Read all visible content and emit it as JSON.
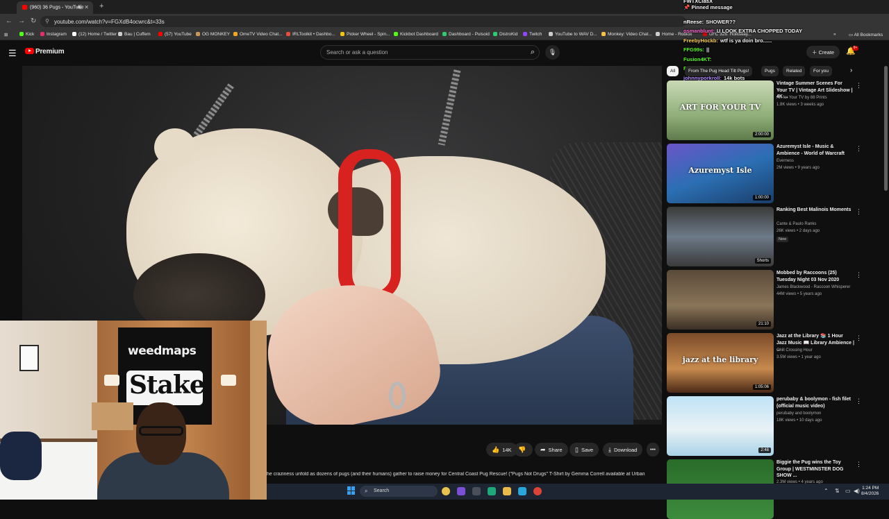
{
  "browser": {
    "tab_title": "(960) 36 Pugs - YouTube",
    "url": "youtube.com/watch?v=FGXdB4ocwrc&t=33s",
    "bookmarks": [
      {
        "label": "Kick",
        "color": "#53fc18"
      },
      {
        "label": "Instagram",
        "color": "#e1306c"
      },
      {
        "label": "(12) Home / Twitter",
        "color": "#ffffff"
      },
      {
        "label": "Bau | Cuffem",
        "color": "#cccccc"
      },
      {
        "label": "(57) YouTube",
        "color": "#ff0000"
      },
      {
        "label": "OG MONKEY",
        "color": "#c89a5a"
      },
      {
        "label": "OmeTV Video Chat...",
        "color": "#f5a623"
      },
      {
        "label": "IRLToolkit • Dashbo...",
        "color": "#e74c3c"
      },
      {
        "label": "Picker Wheel - Spin...",
        "color": "#f1c40f"
      },
      {
        "label": "Kickbot Dashboard",
        "color": "#53fc18"
      },
      {
        "label": "Dashboard - Pulsoid",
        "color": "#2ecc71"
      },
      {
        "label": "DistroKid",
        "color": "#2ecc71"
      },
      {
        "label": "Twitch",
        "color": "#9146ff"
      },
      {
        "label": "YouTube to WAV D...",
        "color": "#cccccc"
      },
      {
        "label": "Monkey: Video Chat...",
        "color": "#f5c04a"
      },
      {
        "label": "Home - Roblox",
        "color": "#cccccc"
      },
      {
        "label": "UFC 326: Holloway...",
        "color": "#d20a0a"
      }
    ],
    "all_bookmarks": "All Bookmarks"
  },
  "youtube": {
    "logo_text": "Premium",
    "search_placeholder": "Search or ask a question",
    "create_label": "Create",
    "notif_count": "9+"
  },
  "chat": {
    "pinned": "Pinned message",
    "messages": [
      {
        "user": "FWTXClasX",
        "text": "",
        "color": "#ffffff"
      },
      {
        "user": "nReese:",
        "text": "SHOWER??",
        "color": "#ffffff"
      },
      {
        "user": "osmanblunt:",
        "text": "U LOOK EXTRA CHOPPED TODAY",
        "color": "#ff6ad5"
      },
      {
        "user": "FreebyHockb:",
        "text": "wtf is ya doin bro......",
        "color": "#ffd34e"
      },
      {
        "user": "FFG99s:",
        "text": "||",
        "color": "#53fc18"
      },
      {
        "user": "Fusion4KT:",
        "text": "",
        "color": "#53fc18"
      },
      {
        "user": "Fusion4KT:",
        "text": "",
        "color": "#53fc18"
      },
      {
        "user": "johnnyporkroll:",
        "text": "14k bots",
        "color": "#b28dff"
      }
    ]
  },
  "video_actions": {
    "like_count": "14K",
    "share": "Share",
    "save": "Save",
    "download": "Download",
    "description": "he craziness unfold as dozens of pugs (and their humans) gather to raise money for Central Coast Pug Rescue! (\"Pugs Not Drugs\" T-Shirt by Gemma Correll available at Urban"
  },
  "webcam": {
    "banner_top": "weedmaps",
    "banner_bottom": "Stake"
  },
  "chips": [
    "All",
    "From The Pug Head Tilt Pugs!",
    "Pugs",
    "Related",
    "For you"
  ],
  "recommendations": [
    {
      "title": "Vintage Summer Scenes For Your TV | Vintage Art Slideshow | 4K ...",
      "channel": "Art for Your TV by 88 Prints",
      "meta": "1.8K views • 3 weeks ago",
      "duration": "2:00:00",
      "thumb_text": "ART FOR YOUR TV",
      "badge": ""
    },
    {
      "title": "Azuremyst Isle - Music & Ambience - World of Warcraft",
      "channel": "Everness",
      "meta": "2M views • 9 years ago",
      "duration": "1:00:00",
      "thumb_text": "Azuremyst Isle",
      "badge": ""
    },
    {
      "title": "Ranking Best Malinois Moments",
      "channel": "Cante & Paulo Ranks",
      "meta": "26K views • 2 days ago",
      "duration": "Shorts",
      "thumb_text": "",
      "badge": "New"
    },
    {
      "title": "Mobbed by Raccoons (25) Tuesday Night 03 Nov 2020",
      "channel": "James Blackwood - Raccoon Whisperer",
      "meta": "44M views • 5 years ago",
      "duration": "21:10",
      "thumb_text": "",
      "badge": ""
    },
    {
      "title": "Jazz at the Library 📚 1 Hour Jazz Music 📖 Library Ambience | ...",
      "channel": "Chill Crossing Hour",
      "meta": "3.5M views • 1 year ago",
      "duration": "1:05:06",
      "thumb_text": "jazz at the library",
      "badge": ""
    },
    {
      "title": "perubaby & boolymon - fish filet (official music video)",
      "channel": "perubaby and boolymon",
      "meta": "18K views • 10 days ago",
      "duration": "2:48",
      "thumb_text": "",
      "badge": ""
    },
    {
      "title": "Biggie the Pug wins the Toy Group | WESTMINSTER DOG SHOW ...",
      "channel": "",
      "meta": "2.3M views • 4 years ago",
      "duration": "",
      "thumb_text": "",
      "badge": ""
    }
  ],
  "taskbar": {
    "search": "Search",
    "time": "1:24 PM",
    "date": "8/4/2026"
  }
}
